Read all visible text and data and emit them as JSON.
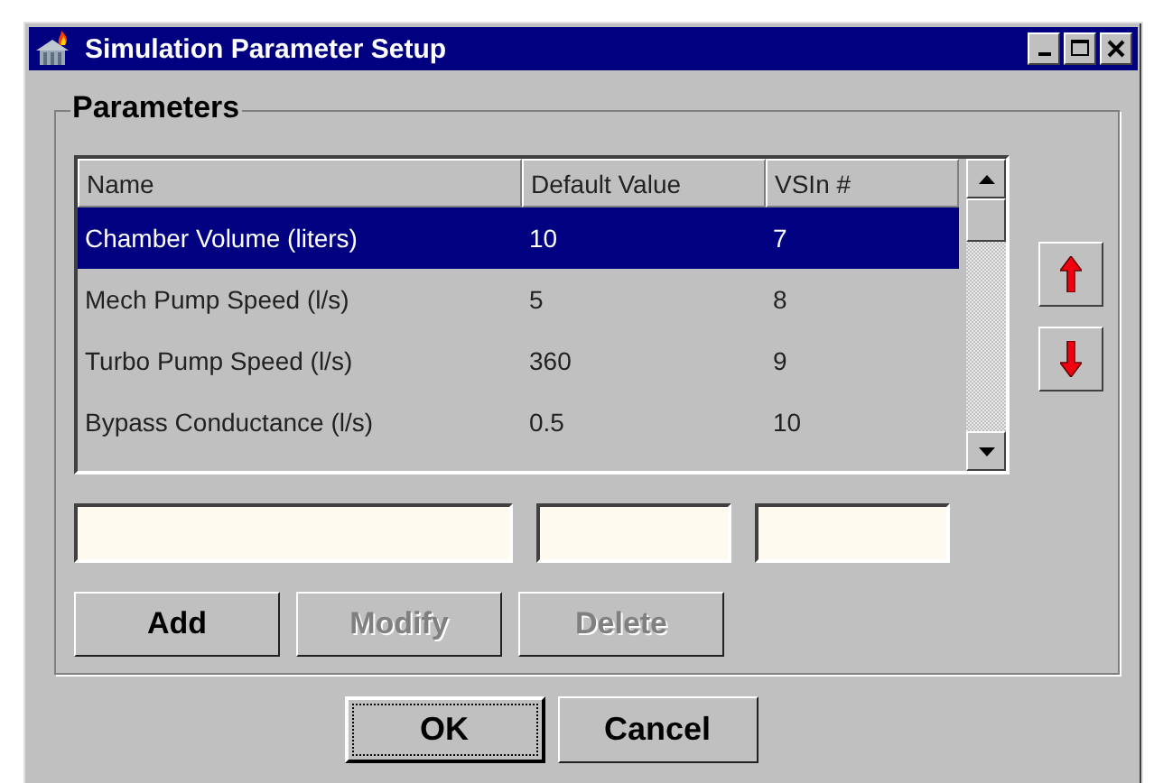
{
  "window": {
    "title": "Simulation Parameter Setup",
    "controls": [
      {
        "kind": "minimize"
      },
      {
        "kind": "maximize"
      },
      {
        "kind": "close"
      }
    ]
  },
  "group": {
    "title": "Parameters"
  },
  "table": {
    "columns": [
      "Name",
      "Default Value",
      "VSIn #"
    ],
    "rows": [
      {
        "cells": [
          "Chamber Volume (liters)",
          "10",
          "7"
        ],
        "selected": true
      },
      {
        "cells": [
          "Mech Pump Speed (l/s)",
          "5",
          "8"
        ],
        "selected": false
      },
      {
        "cells": [
          "Turbo Pump Speed (l/s)",
          "360",
          "9"
        ],
        "selected": false
      },
      {
        "cells": [
          "Bypass Conductance (l/s)",
          "0.5",
          "10"
        ],
        "selected": false
      }
    ]
  },
  "move_buttons": [
    {
      "kind": "up"
    },
    {
      "kind": "down"
    }
  ],
  "fields": [
    {
      "kind": "name"
    },
    {
      "kind": "value"
    },
    {
      "kind": "vsin"
    }
  ],
  "buttons": [
    {
      "label": "Add",
      "disabled": false
    },
    {
      "label": "Modify",
      "disabled": true
    },
    {
      "label": "Delete",
      "disabled": true
    }
  ],
  "dialog_buttons": [
    {
      "label": "OK",
      "focused": true
    },
    {
      "label": "Cancel",
      "focused": false
    }
  ]
}
